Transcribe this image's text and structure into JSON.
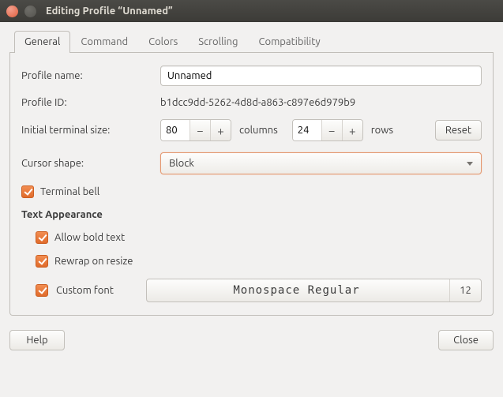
{
  "window": {
    "title": "Editing Profile “Unnamed”"
  },
  "tabs": [
    "General",
    "Command",
    "Colors",
    "Scrolling",
    "Compatibility"
  ],
  "active_tab": 0,
  "fields": {
    "profile_name_label": "Profile name:",
    "profile_name_value": "Unnamed",
    "profile_id_label": "Profile ID:",
    "profile_id_value": "b1dcc9dd-5262-4d8d-a863-c897e6d979b9",
    "term_size_label": "Initial terminal size:",
    "cols_value": "80",
    "cols_label": "columns",
    "rows_value": "24",
    "rows_label": "rows",
    "reset_label": "Reset",
    "cursor_label": "Cursor shape:",
    "cursor_value": "Block",
    "terminal_bell_label": "Terminal bell",
    "section_head": "Text Appearance",
    "allow_bold_label": "Allow bold text",
    "rewrap_label": "Rewrap on resize",
    "custom_font_label": "Custom font",
    "font_name": "Monospace Regular",
    "font_size": "12"
  },
  "footer": {
    "help": "Help",
    "close": "Close"
  }
}
